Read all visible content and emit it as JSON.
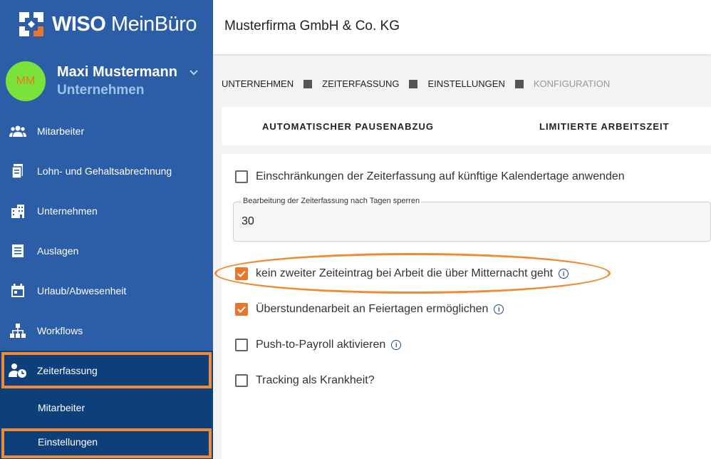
{
  "app": {
    "brand_prefix": "WISO",
    "brand_suffix": "MeinBüro"
  },
  "user": {
    "initials": "MM",
    "name": "Maxi Mustermann",
    "org": "Unternehmen"
  },
  "nav": [
    {
      "label": "Mitarbeiter",
      "icon": "people-icon"
    },
    {
      "label": "Lohn- und Gehaltsabrechnung",
      "icon": "payroll-document-icon"
    },
    {
      "label": "Unternehmen",
      "icon": "building-icon"
    },
    {
      "label": "Auslagen",
      "icon": "receipt-icon"
    },
    {
      "label": "Urlaub/Abwesenheit",
      "icon": "calendar-icon"
    },
    {
      "label": "Workflows",
      "icon": "workflow-icon"
    },
    {
      "label": "Zeiterfassung",
      "icon": "user-clock-icon",
      "active": true
    }
  ],
  "subnav": [
    {
      "label": "Mitarbeiter"
    },
    {
      "label": "Einstellungen",
      "active": true
    }
  ],
  "header": {
    "company": "Musterfirma GmbH & Co. KG"
  },
  "breadcrumb": [
    "UNTERNEHMEN",
    "ZEITERFASSUNG",
    "EINSTELLUNGEN",
    "KONFIGURATION"
  ],
  "tabs": [
    "AUTOMATISCHER PAUSENABZUG",
    "LIMITIERTE ARBEITSZEIT"
  ],
  "settings": {
    "restrict_future": {
      "label": "Einschränkungen der Zeiterfassung auf künftige Kalendertage anwenden",
      "checked": false
    },
    "lock_days": {
      "label": "Bearbeitung der Zeiterfassung nach Tagen sperren",
      "value": "30"
    },
    "no_second_entry": {
      "label": "kein zweiter Zeiteintrag bei Arbeit die über Mitternacht geht",
      "checked": true
    },
    "holiday_overtime": {
      "label": "Überstundenarbeit an Feiertagen ermöglichen",
      "checked": true
    },
    "push_to_payroll": {
      "label": "Push-to-Payroll aktivieren",
      "checked": false
    },
    "tracking_sick": {
      "label": "Tracking als Krankheit?",
      "checked": false
    }
  },
  "colors": {
    "sidebar": "#2b5ea6",
    "sidebar_active": "#0d3f7a",
    "accent": "#e8772e",
    "avatar": "#79e33a"
  }
}
